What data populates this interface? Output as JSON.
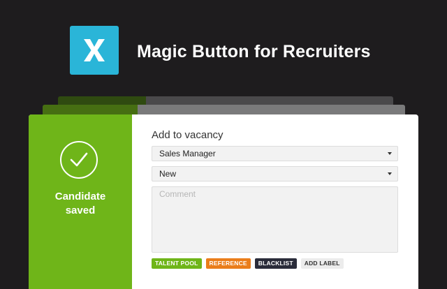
{
  "header": {
    "logo_letter": "X",
    "logo_color": "#2ab5d8",
    "title": "Magic Button for Recruiters"
  },
  "status": {
    "icon": "checkmark-icon",
    "line1": "Candidate",
    "line2": "saved",
    "color": "#6fb519"
  },
  "form": {
    "label": "Add to vacancy",
    "vacancy_select": "Sales Manager",
    "stage_select": "New",
    "comment_placeholder": "Comment",
    "tags": [
      {
        "label": "TALENT POOL",
        "color": "#6fb519"
      },
      {
        "label": "REFERENCE",
        "color": "#ea7d1a"
      },
      {
        "label": "BLACKLIST",
        "color": "#2a2c3a"
      }
    ],
    "add_label": "ADD LABEL"
  }
}
